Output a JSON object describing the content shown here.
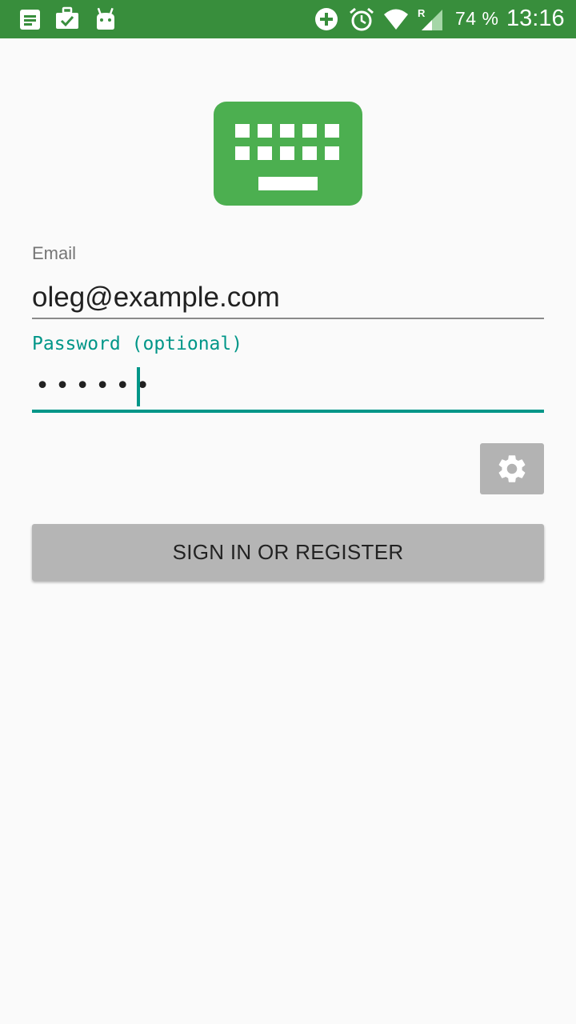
{
  "status_bar": {
    "battery_text": "74 %",
    "time": "13:16",
    "roaming_indicator": "R",
    "icons": [
      "notes-icon",
      "briefcase-check-icon",
      "android-icon",
      "add-circle-icon",
      "alarm-icon",
      "wifi-icon",
      "cell-signal-icon"
    ],
    "background_color": "#388e3c"
  },
  "logo": {
    "icon": "keyboard-icon",
    "color": "#4caf50"
  },
  "form": {
    "email_label": "Email",
    "email_value": "oleg@example.com",
    "password_label": "Password (optional)",
    "password_value_masked": "••••••",
    "accent_color": "#009688"
  },
  "actions": {
    "settings_icon": "gear-icon",
    "signin_label": "SIGN IN OR REGISTER"
  }
}
